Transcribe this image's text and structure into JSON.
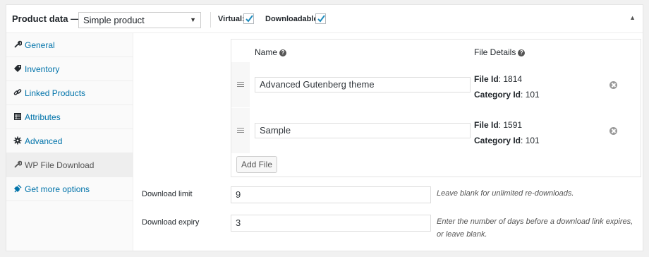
{
  "header": {
    "title": "Product data —",
    "product_type": "Simple product",
    "virtual_label": "Virtual:",
    "virtual_checked": true,
    "downloadable_label": "Downloadable:",
    "downloadable_checked": true
  },
  "sidebar": {
    "items": [
      {
        "label": "General",
        "icon": "wrench-icon",
        "active": false
      },
      {
        "label": "Inventory",
        "icon": "tag-icon",
        "active": false
      },
      {
        "label": "Linked Products",
        "icon": "link-icon",
        "active": false
      },
      {
        "label": "Attributes",
        "icon": "table-icon",
        "active": false
      },
      {
        "label": "Advanced",
        "icon": "gear-icon",
        "active": false
      },
      {
        "label": "WP File Download",
        "icon": "wrench-icon",
        "active": true
      },
      {
        "label": "Get more options",
        "icon": "plugin-icon",
        "active": false
      }
    ]
  },
  "files": {
    "col_name": "Name",
    "col_details": "File Details",
    "file_id_label": "File Id",
    "category_id_label": "Category Id",
    "rows": [
      {
        "name": "Advanced Gutenberg theme",
        "file_id": "1814",
        "category_id": "101"
      },
      {
        "name": "Sample",
        "file_id": "1591",
        "category_id": "101"
      }
    ],
    "add_button": "Add File"
  },
  "download_limit": {
    "label": "Download limit",
    "value": "9",
    "hint": "Leave blank for unlimited re-downloads."
  },
  "download_expiry": {
    "label": "Download expiry",
    "value": "3",
    "hint": "Enter the number of days before a download link expires, or leave blank."
  },
  "colors": {
    "link": "#0073aa",
    "checkmark": "#1e8cbe"
  }
}
